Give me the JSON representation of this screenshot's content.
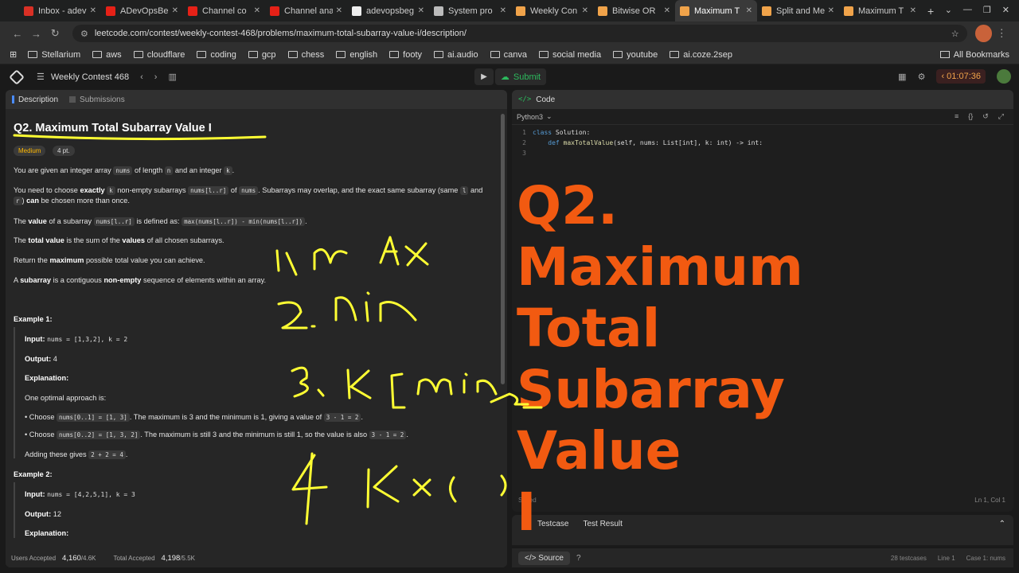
{
  "browser": {
    "tabs": [
      {
        "label": "Inbox - adev",
        "color": "#d93025"
      },
      {
        "label": "ADevOpsBe",
        "color": "#e62117"
      },
      {
        "label": "Channel co",
        "color": "#e62117"
      },
      {
        "label": "Channel ana",
        "color": "#e62117"
      },
      {
        "label": "adevopsbeg",
        "color": "#eeeeee"
      },
      {
        "label": "System pro",
        "color": "#bbbbbb"
      },
      {
        "label": "Weekly Con",
        "color": "#f0a34a"
      },
      {
        "label": "Bitwise OR",
        "color": "#f0a34a"
      },
      {
        "label": "Maximum T",
        "color": "#f0a34a"
      },
      {
        "label": "Split and Me",
        "color": "#f0a34a"
      },
      {
        "label": "Maximum T",
        "color": "#f0a34a"
      }
    ],
    "url": "leetcode.com/contest/weekly-contest-468/problems/maximum-total-subarray-value-i/description/",
    "bookmarks": [
      "Stellarium",
      "aws",
      "cloudflare",
      "coding",
      "gcp",
      "chess",
      "english",
      "footy",
      "ai.audio",
      "canva",
      "social media",
      "youtube",
      "ai.coze.2sep"
    ],
    "all_bookmarks": "All Bookmarks"
  },
  "header": {
    "contest": "Weekly Contest 468",
    "submit": "Submit",
    "timer": "01:07:36"
  },
  "left": {
    "tabs": [
      "Description",
      "Submissions"
    ],
    "title": "Q2. Maximum Total Subarray Value I",
    "difficulty": "Medium",
    "points": "4 pt.",
    "p1_a": "You are given an integer array",
    "p1_code1": "nums",
    "p1_b": "of length",
    "p1_code2": "n",
    "p1_c": "and an integer",
    "p1_code3": "k",
    "p1_d": ".",
    "p2_a": "You need to choose",
    "p2_b": "exactly",
    "p2_code1": "k",
    "p2_c": "non-empty subarrays",
    "p2_code2": "nums[l..r]",
    "p2_d": "of",
    "p2_code3": "nums",
    "p2_e": ". Subarrays may overlap, and the exact same subarray (same",
    "p2_code4": "l",
    "p2_f": "and",
    "p2_code5": "r",
    "p2_g": ")",
    "p2_h": "can",
    "p2_i": "be chosen more than once.",
    "p3_a": "The",
    "p3_b": "value",
    "p3_c": "of a subarray",
    "p3_code1": "nums[l..r]",
    "p3_d": "is defined as:",
    "p3_code2": "max(nums[l..r]) - min(nums[l..r])",
    "p3_e": ".",
    "p4_a": "The",
    "p4_b": "total value",
    "p4_c": "is the sum of the",
    "p4_d": "values",
    "p4_e": "of all chosen subarrays.",
    "p5_a": "Return the",
    "p5_b": "maximum",
    "p5_c": "possible total value you can achieve.",
    "p6_a": "A",
    "p6_b": "subarray",
    "p6_c": "is a contiguous",
    "p6_d": "non-empty",
    "p6_e": "sequence of elements within an array.",
    "ex1_title": "Example 1:",
    "input_label": "Input:",
    "ex1_input": "nums = [1,3,2], k = 2",
    "output_label": "Output:",
    "ex1_output": "4",
    "explanation_label": "Explanation:",
    "ex1_exp": "One optimal approach is:",
    "ex1_b1_a": "Choose",
    "ex1_b1_code": "nums[0..1] = [1, 3]",
    "ex1_b1_b": ". The maximum is 3 and the minimum is 1, giving a value of",
    "ex1_b1_code2": "3 - 1 = 2",
    "ex1_b1_c": ".",
    "ex1_b2_a": "Choose",
    "ex1_b2_code": "nums[0..2] = [1, 3, 2]",
    "ex1_b2_b": ". The maximum is still 3 and the minimum is still 1, so the value is also",
    "ex1_b2_code2": "3 - 1 = 2",
    "ex1_b2_c": ".",
    "ex1_sum_a": "Adding these gives",
    "ex1_sum_code": "2 + 2 = 4",
    "ex1_sum_b": ".",
    "ex2_title": "Example 2:",
    "ex2_input": "nums = [4,2,5,1], k = 3",
    "ex2_output": "12",
    "footer_users_label": "Users Accepted",
    "footer_users_val": "4,160",
    "footer_users_tot": "/4.6K",
    "footer_total_label": "Total Accepted",
    "footer_total_val": "4,198",
    "footer_total_tot": "/5.5K"
  },
  "right": {
    "tab": "Code",
    "language": "Python3",
    "code_l1_kw": "class",
    "code_l1_name": "Solution:",
    "code_l2_kw": "def",
    "code_l2_fn": "maxTotalValue",
    "code_l2_rest": "(self, nums: List[int], k: int) -> int:",
    "saved": "Saved",
    "lncol": "Ln 1, Col 1",
    "overlay": [
      "Q2.",
      "Maximum",
      "Total",
      "Subarray",
      "Value",
      "I"
    ],
    "test_tabs": [
      "Testcase",
      "Test Result"
    ],
    "source": "Source",
    "testcases": "28 testcases",
    "line_info": "Line 1",
    "case_info": "Case 1: nums"
  },
  "annotation_color": "#ffff33",
  "accent_color": "#f25a11"
}
